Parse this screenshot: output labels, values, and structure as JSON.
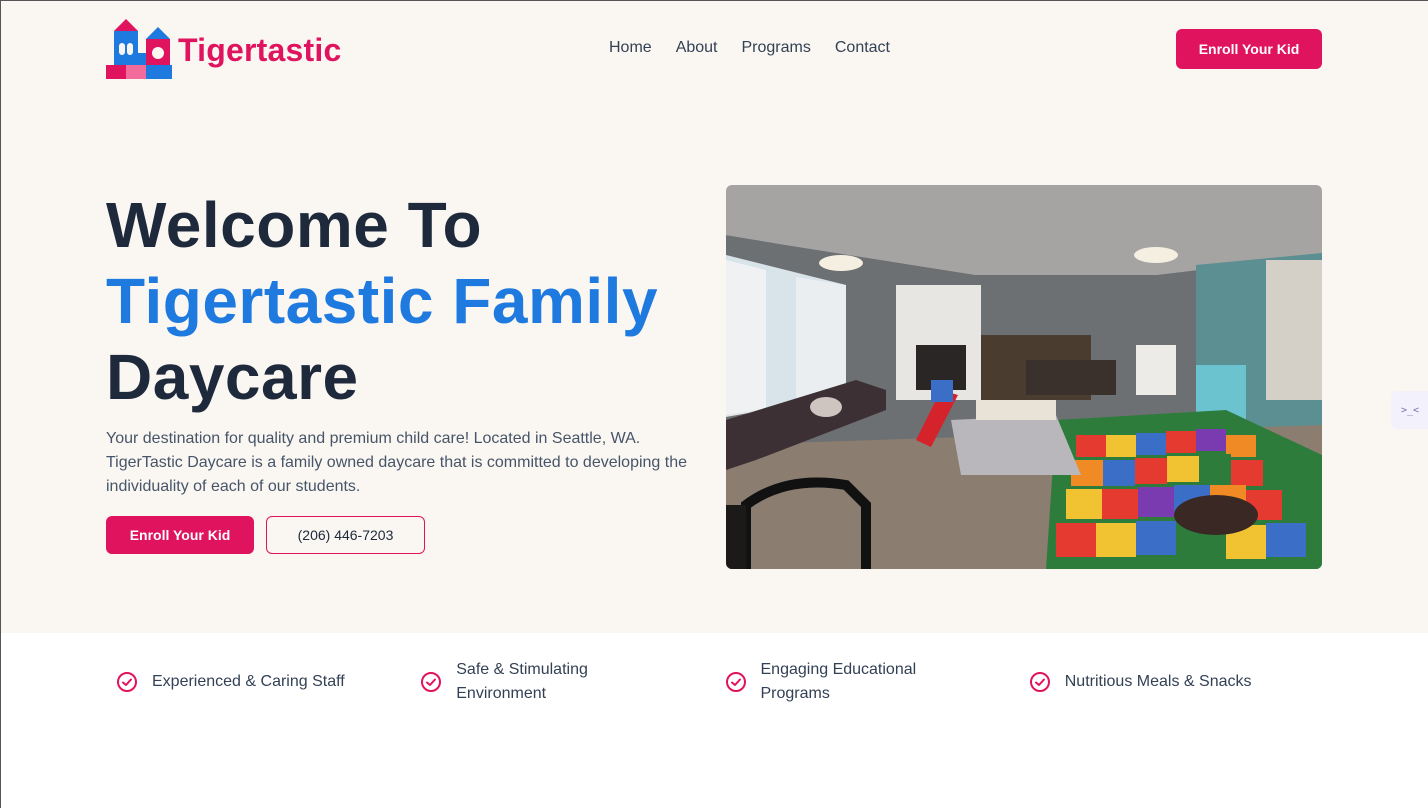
{
  "brand": {
    "name": "Tigertastic",
    "color": "#e0135e",
    "accent_blue": "#1f7ae0"
  },
  "nav": {
    "items": [
      {
        "label": "Home"
      },
      {
        "label": "About"
      },
      {
        "label": "Programs"
      },
      {
        "label": "Contact"
      }
    ],
    "cta_label": "Enroll Your Kid"
  },
  "hero": {
    "title_line1": "Welcome To",
    "title_line2": "Tigertastic Family",
    "title_line3": "Daycare",
    "description": "Your destination for quality and premium child care! Located in Seattle, WA. TigerTastic Daycare is a family owned daycare that is committed to developing the individuality of each of our students.",
    "primary_button": "Enroll Your Kid",
    "phone_button": "(206) 446-7203"
  },
  "features": [
    {
      "label": "Experienced & Caring Staff",
      "icon": "check-circle-icon"
    },
    {
      "label": "Safe & Stimulating Environment",
      "icon": "check-circle-icon"
    },
    {
      "label": "Engaging Educational Programs",
      "icon": "check-circle-icon"
    },
    {
      "label": "Nutritious Meals & Snacks",
      "icon": "check-circle-icon"
    }
  ],
  "side_widget": {
    "glyph": ">_<"
  }
}
